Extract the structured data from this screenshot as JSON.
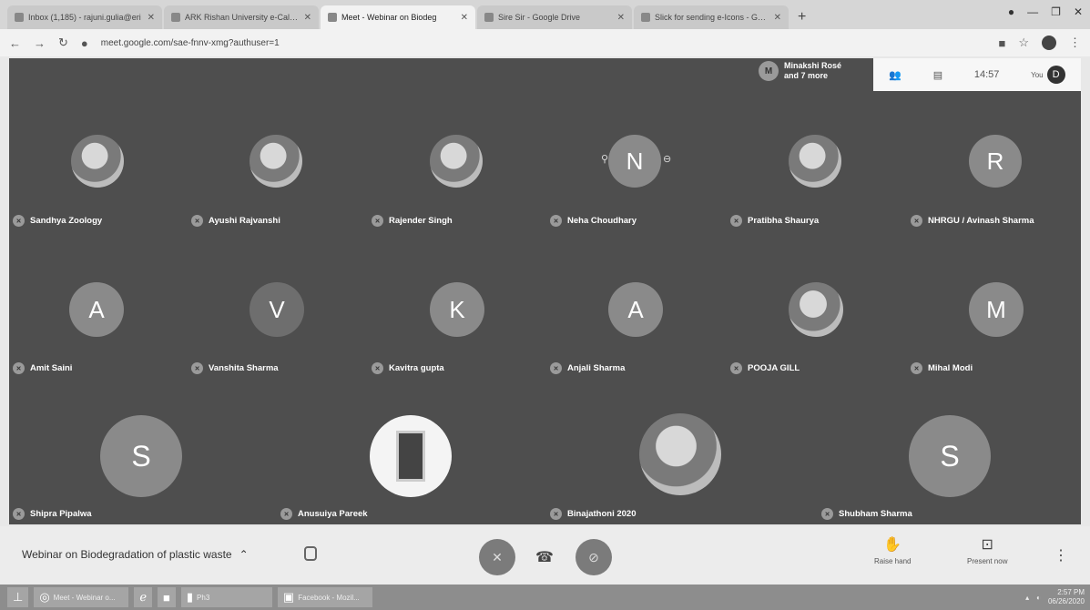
{
  "browser": {
    "tabs": [
      {
        "title": "Inbox (1,185) - rajuni.gulia@eri"
      },
      {
        "title": "ARK Rishan University e-Calend"
      },
      {
        "title": "Meet - Webinar on Biodeg"
      },
      {
        "title": "Sire Sir - Google Drive"
      },
      {
        "title": "Slick for sending e-Icons - Google"
      }
    ],
    "new_tab": "+",
    "url": "meet.google.com/sae-fnnv-xmg?authuser=1"
  },
  "meet": {
    "top_card_chip": {
      "initial": "M",
      "line1": "Minakshi Rosé",
      "line2": "and 7 more"
    },
    "clock": "14:57",
    "self_initial": "D",
    "self_label": "You",
    "participants": [
      {
        "name": "Sandhya Zoology",
        "initial": "",
        "kind": "photo"
      },
      {
        "name": "Ayushi Rajvanshi",
        "initial": "",
        "kind": "photo"
      },
      {
        "name": "Rajender Singh",
        "initial": "",
        "kind": "photo"
      },
      {
        "name": "Neha Choudhary",
        "initial": "N",
        "kind": "letter"
      },
      {
        "name": "Pratibha Shaurya",
        "initial": "",
        "kind": "photo"
      },
      {
        "name": "NHRGU / Avinash Sharma",
        "initial": "R",
        "kind": "letter"
      },
      {
        "name": "Amit Saini",
        "initial": "A",
        "kind": "letter"
      },
      {
        "name": "Vanshita Sharma",
        "initial": "V",
        "kind": "dark"
      },
      {
        "name": "Kavitra gupta",
        "initial": "K",
        "kind": "letter"
      },
      {
        "name": "Anjali Sharma",
        "initial": "A",
        "kind": "letter"
      },
      {
        "name": "POOJA GILL",
        "initial": "",
        "kind": "photo"
      },
      {
        "name": "Mihal Modi",
        "initial": "M",
        "kind": "letter"
      },
      {
        "name": "Shipra Pipalwa",
        "initial": "S",
        "kind": "letter"
      },
      {
        "name": "Anusuiya Pareek",
        "initial": "",
        "kind": "white"
      },
      {
        "name": "Binajathoni 2020",
        "initial": "",
        "kind": "photo"
      },
      {
        "name": "Shubham Sharma",
        "initial": "S",
        "kind": "letter"
      }
    ],
    "meeting_title": "Webinar on Biodegradation of plastic waste",
    "raise_hand": "Raise hand",
    "present_now": "Present now"
  },
  "taskbar": {
    "items": [
      {
        "label": "Meet - Webinar o..."
      },
      {
        "label": ""
      },
      {
        "label": ""
      },
      {
        "label": "Ph3"
      },
      {
        "label": "Facebook - Mozil..."
      }
    ],
    "time": "2:57 PM",
    "date": "06/26/2020"
  },
  "colors": {
    "stage_bg": "#4e4e4e",
    "controls_bg": "#ececec",
    "taskbar_bg": "#8d8d8d"
  }
}
